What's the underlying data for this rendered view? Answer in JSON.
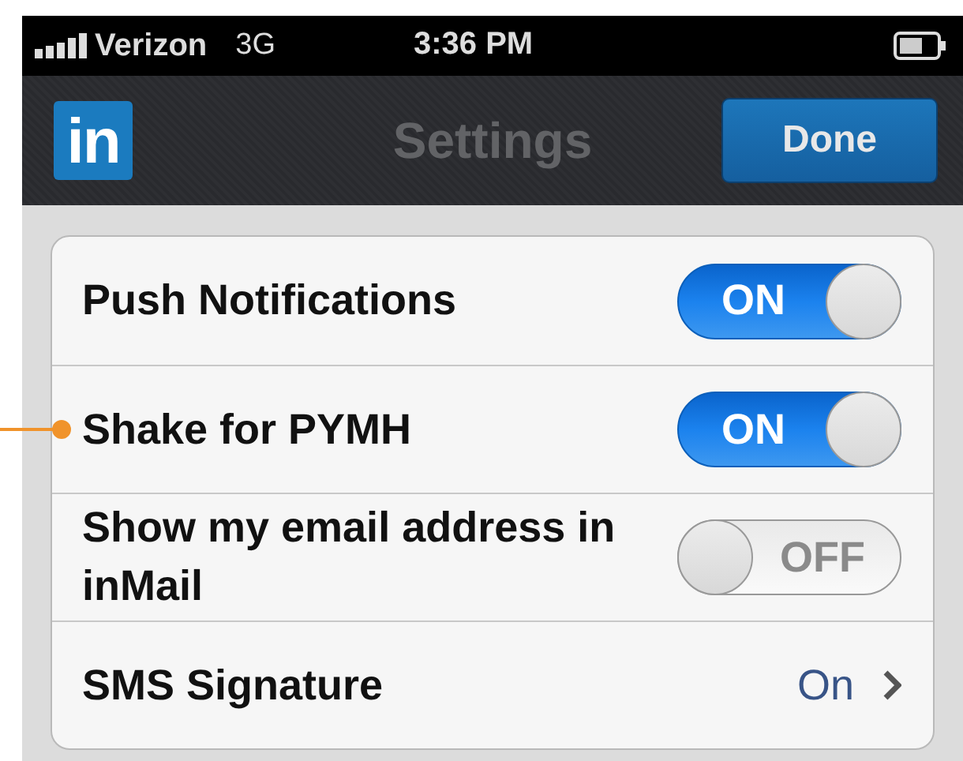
{
  "status_bar": {
    "carrier": "Verizon",
    "network": "3G",
    "time": "3:36 PM"
  },
  "nav_bar": {
    "title": "Settings",
    "done_button": "Done",
    "logo": "in"
  },
  "settings": [
    {
      "kind": "toggle",
      "label": "Push Notifications",
      "on": true,
      "switch_text": "ON"
    },
    {
      "kind": "toggle",
      "label": "Shake for PYMH",
      "on": true,
      "switch_text": "ON",
      "annotated": true
    },
    {
      "kind": "toggle",
      "label": "Show my email address in inMail",
      "on": false,
      "switch_text": "OFF"
    },
    {
      "kind": "disclosure",
      "label": "SMS Signature",
      "value": "On"
    }
  ]
}
